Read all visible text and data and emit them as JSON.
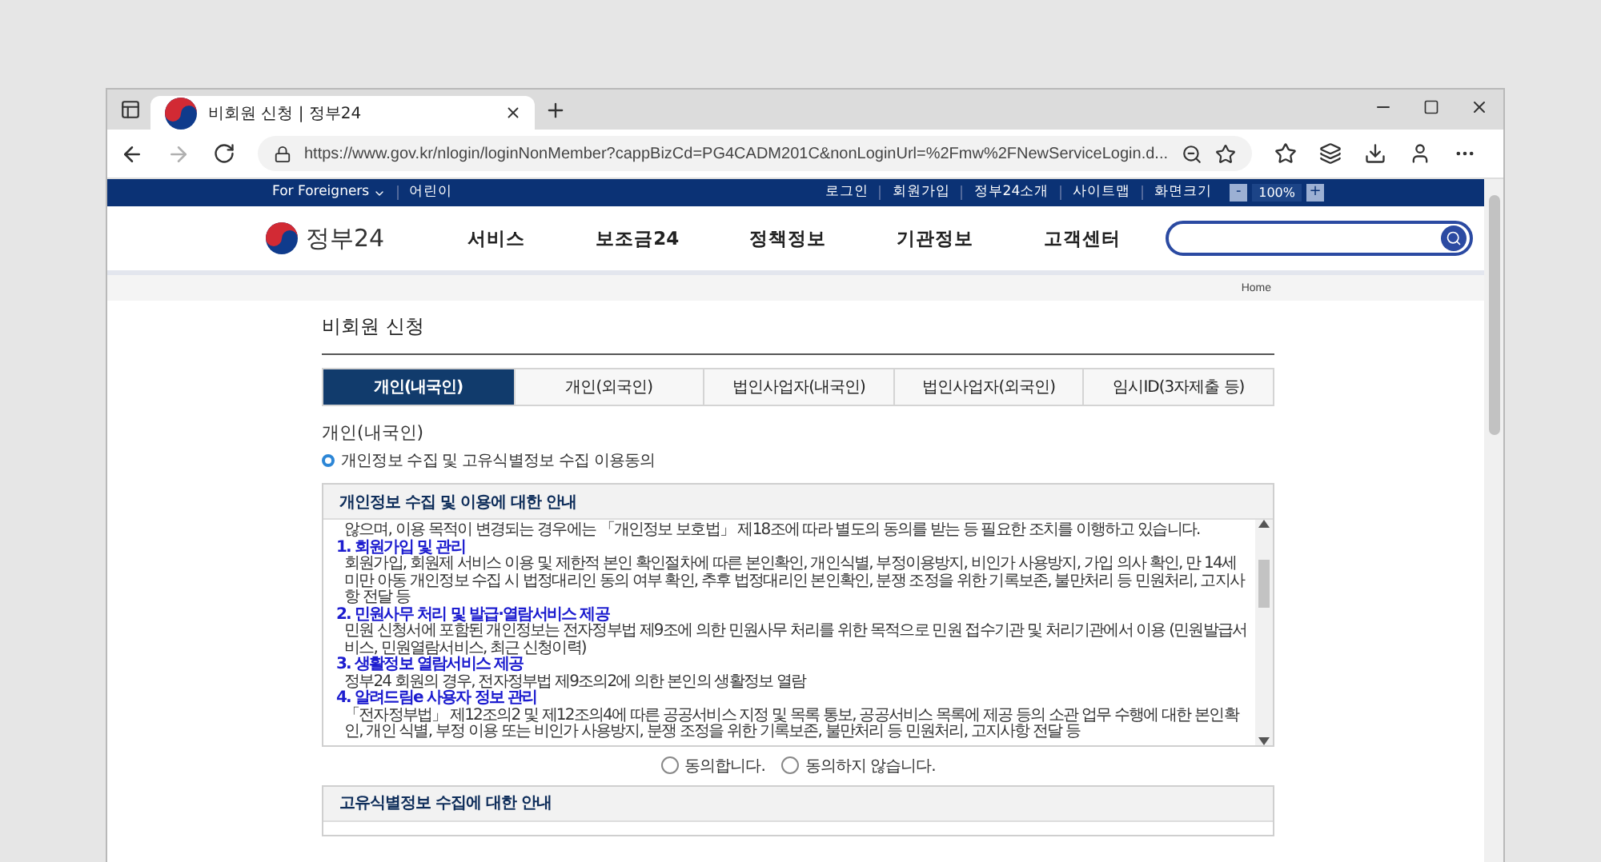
{
  "browser": {
    "tab_title": "비회원 신청 | 정부24",
    "url": "https://www.gov.kr/nlogin/loginNonMember?cappBizCd=PG4CADM201C&nonLoginUrl=%2Fmw%2FNewServiceLogin.d..."
  },
  "top_bar": {
    "left": [
      {
        "label": "For Foreigners",
        "dropdown": true
      },
      {
        "label": "어린이",
        "dropdown": false
      }
    ],
    "right": [
      "로그인",
      "회원가입",
      "정부24소개",
      "사이트맵",
      "화면크기"
    ],
    "zoom": {
      "minus": "-",
      "value": "100%",
      "plus": "+"
    }
  },
  "header": {
    "logo": "정부24",
    "nav": [
      "서비스",
      "보조금24",
      "정책정보",
      "기관정보",
      "고객센터"
    ]
  },
  "breadcrumb": "Home",
  "page_title": "비회원 신청",
  "tabs": [
    {
      "label": "개인(내국인)",
      "selected": true
    },
    {
      "label": "개인(외국인)",
      "selected": false
    },
    {
      "label": "법인사업자(내국인)",
      "selected": false
    },
    {
      "label": "법인사업자(외국인)",
      "selected": false
    },
    {
      "label": "임시ID(3자제출 등)",
      "selected": false
    }
  ],
  "section_title": "개인(내국인)",
  "section_bullet": "개인정보 수집 및 고유식별정보 수집 이용동의",
  "privacy_panel": {
    "title": "개인정보 수집 및 이용에 대한 안내",
    "paragraphs": [
      {
        "kind": "text",
        "text": "않으며, 이용 목적이 변경되는 경우에는 「개인정보 보호법」 제18조에 따라 별도의 동의를 받는 등 필요한 조치를 이행하고 있습니다."
      },
      {
        "kind": "heading",
        "text": "1. 회원가입 및 관리"
      },
      {
        "kind": "text",
        "text": "회원가입, 회원제 서비스 이용 및 제한적 본인 확인절차에 따른 본인확인, 개인식별, 부정이용방지, 비인가 사용방지, 가입 의사 확인, 만 14세 미만 아동 개인정보 수집 시 법정대리인 동의 여부 확인, 추후 법정대리인 본인확인, 분쟁 조정을 위한 기록보존, 불만처리 등 민원처리, 고지사항 전달 등"
      },
      {
        "kind": "heading",
        "text": "2. 민원사무 처리 및 발급·열람서비스 제공"
      },
      {
        "kind": "text",
        "text": "민원 신청서에 포함된 개인정보는 전자정부법 제9조에 의한 민원사무 처리를 위한 목적으로 민원 접수기관 및 처리기관에서 이용 (민원발급서비스, 민원열람서비스, 최근 신청이력)"
      },
      {
        "kind": "heading",
        "text": "3. 생활정보 열람서비스 제공"
      },
      {
        "kind": "text",
        "text": "정부24 회원의 경우, 전자정부법 제9조의2에 의한 본인의 생활정보 열람"
      },
      {
        "kind": "heading",
        "text": "4. 알려드림e 사용자 정보 관리"
      },
      {
        "kind": "text",
        "text": "「전자정부법」 제12조의2 및 제12조의4에 따른 공공서비스 지정 및 목록 통보, 공공서비스 목록에 제공 등의 소관 업무 수행에 대한 본인확인, 개인 식별, 부정 이용 또는 비인가 사용방지, 분쟁 조정을 위한 기록보존, 불만처리 등 민원처리, 고지사항 전달 등"
      }
    ]
  },
  "consent": [
    {
      "label": "동의합니다.",
      "selected": false
    },
    {
      "label": "동의하지 않습니다.",
      "selected": false
    }
  ],
  "unique_id_panel": {
    "title": "고유식별정보 수집에 대한 안내"
  }
}
